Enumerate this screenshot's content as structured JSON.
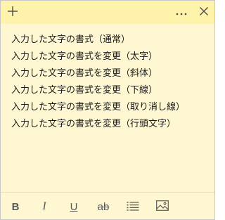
{
  "toolbar": {
    "add_icon": "plus-icon",
    "more_label": "···",
    "close_icon": "close-icon"
  },
  "note": {
    "lines": [
      "入力した文字の書式（通常）",
      "入力した文字の書式を変更（太字）",
      "入力した文字の書式を変更（斜体）",
      "入力した文字の書式を変更（下線）",
      "入力した文字の書式を変更（取り消し線）",
      "入力した文字の書式を変更（行頭文字）"
    ]
  },
  "format_bar": {
    "bold": "B",
    "italic": "I",
    "underline": "U",
    "strikethrough": "ab",
    "bullets_icon": "bullet-list-icon",
    "image_icon": "image-icon"
  },
  "colors": {
    "note_background": "#fff7d1",
    "titlebar_background": "#fff2ab"
  }
}
